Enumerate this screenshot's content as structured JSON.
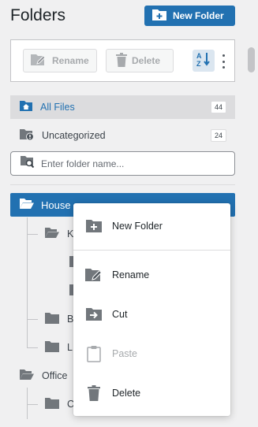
{
  "header": {
    "title": "Folders",
    "new_folder_label": "New Folder"
  },
  "toolbar": {
    "rename_label": "Rename",
    "delete_label": "Delete",
    "sort_icon": "sort-az-icon",
    "more_icon": "kebab-menu-icon"
  },
  "nav": {
    "all_files": {
      "label": "All Files",
      "count": "44"
    },
    "uncategorized": {
      "label": "Uncategorized",
      "count": "24"
    }
  },
  "search": {
    "placeholder": "Enter folder name..."
  },
  "tree": {
    "selected": "House",
    "items": [
      {
        "label": "K"
      },
      {
        "label": ""
      },
      {
        "label": ""
      },
      {
        "label": "B"
      },
      {
        "label": "L"
      },
      {
        "label": "Office"
      },
      {
        "label": "C"
      }
    ]
  },
  "context_menu": {
    "items": [
      {
        "label": "New Folder",
        "icon": "folder-plus-icon",
        "enabled": true
      },
      {
        "label": "Rename",
        "icon": "folder-edit-icon",
        "enabled": true
      },
      {
        "label": "Cut",
        "icon": "folder-move-icon",
        "enabled": true
      },
      {
        "label": "Paste",
        "icon": "clipboard-icon",
        "enabled": false
      },
      {
        "label": "Delete",
        "icon": "trash-icon",
        "enabled": true
      }
    ]
  },
  "colors": {
    "accent": "#2271b1",
    "background": "#f0f0f1",
    "selected_row": "#dcdcde",
    "icon_gray": "#72777c",
    "disabled": "#a7aaad"
  }
}
